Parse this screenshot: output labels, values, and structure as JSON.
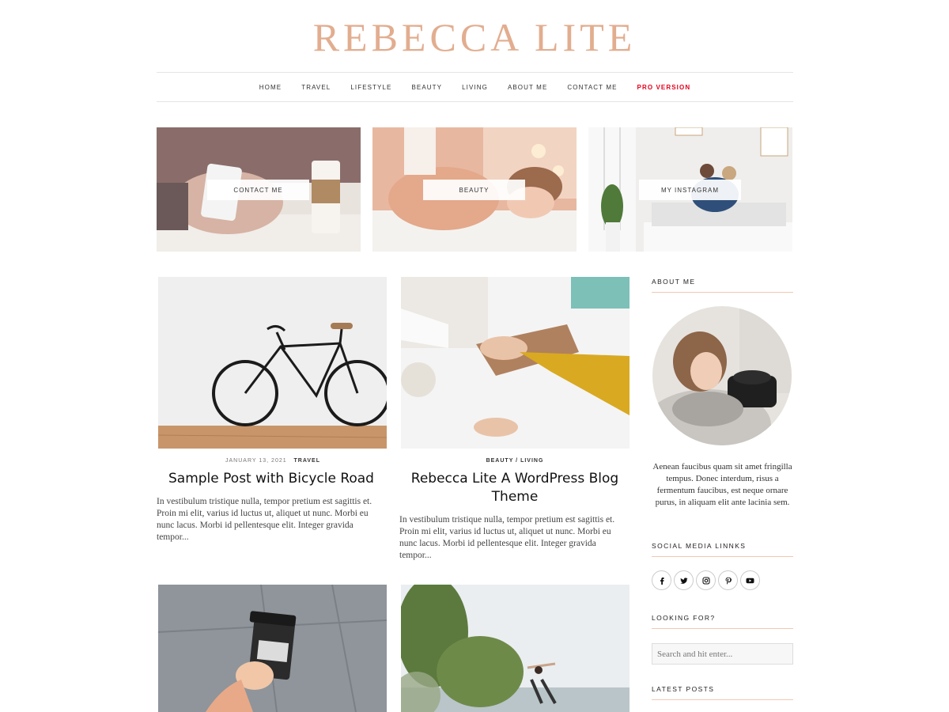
{
  "site": {
    "title": "REBECCA LITE"
  },
  "nav": {
    "items": [
      "HOME",
      "TRAVEL",
      "LIFESTYLE",
      "BEAUTY",
      "LIVING",
      "ABOUT ME",
      "CONTACT ME"
    ],
    "pro": "PRO VERSION",
    "pro_color": "#e0001b"
  },
  "promos": [
    {
      "label": "CONTACT ME"
    },
    {
      "label": "BEAUTY"
    },
    {
      "label": "MY INSTAGRAM"
    }
  ],
  "posts": [
    {
      "date": "JANUARY 13, 2021",
      "category": "TRAVEL",
      "title": "Sample Post with Bicycle Road",
      "excerpt": "In vestibulum tristique nulla, tempor pretium est sagittis et. Proin mi elit, varius id luctus ut, aliquet ut nunc. Morbi eu nunc lacus. Morbi id pellentesque elit. Integer gravida tempor..."
    },
    {
      "category": "BEAUTY / LIVING",
      "title": "Rebecca Lite A WordPress Blog Theme",
      "excerpt": "In vestibulum tristique nulla, tempor pretium est sagittis et. Proin mi elit, varius id luctus ut, aliquet ut nunc. Morbi eu nunc lacus. Morbi id pellentesque elit. Integer gravida tempor..."
    }
  ],
  "sidebar": {
    "about_title": "ABOUT ME",
    "about_text": "Aenean faucibus quam sit amet fringilla tempus. Donec interdum, risus a fermentum faucibus, est neque ornare purus, in aliquam elit ante lacinia sem.",
    "social_title": "SOCIAL MEDIA LINNKS",
    "social_icons": [
      "facebook-icon",
      "twitter-icon",
      "instagram-icon",
      "pinterest-icon",
      "youtube-icon"
    ],
    "search_title": "LOOKING FOR?",
    "search_placeholder": "Search and hit enter...",
    "latest_title": "LATEST POSTS"
  },
  "colors": {
    "accent": "#e2ad8f",
    "divider": "#f1c8b4"
  }
}
